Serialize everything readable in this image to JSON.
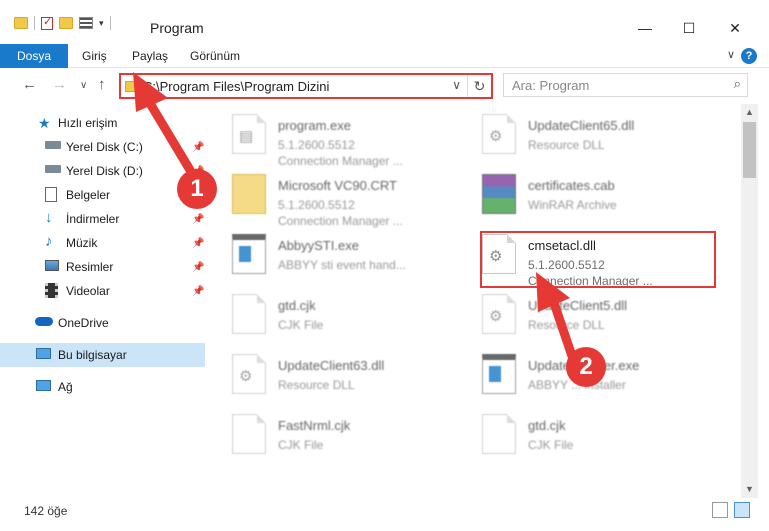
{
  "window": {
    "title": "Program",
    "minimize": "—",
    "maximize": "☐",
    "close": "✕"
  },
  "ribbon": {
    "tabs": [
      {
        "label": "Dosya"
      },
      {
        "label": "Giriş"
      },
      {
        "label": "Paylaş"
      },
      {
        "label": "Görünüm"
      }
    ],
    "help": "?"
  },
  "nav": {
    "back": "←",
    "forward": "→",
    "recent": "∨",
    "up": "↑",
    "address": "C:\\Program Files\\Program Dizini",
    "search_placeholder": "Ara: Program"
  },
  "sidebar": {
    "items": [
      {
        "label": "Hızlı erişim",
        "icon": "star-icon",
        "pinned": false
      },
      {
        "label": "Yerel Disk (C:)",
        "icon": "drive-icon",
        "pinned": true
      },
      {
        "label": "Yerel Disk (D:)",
        "icon": "drive-icon",
        "pinned": true
      },
      {
        "label": "Belgeler",
        "icon": "documents-icon",
        "pinned": true
      },
      {
        "label": "İndirmeler",
        "icon": "download-icon",
        "pinned": true
      },
      {
        "label": "Müzik",
        "icon": "music-icon",
        "pinned": true
      },
      {
        "label": "Resimler",
        "icon": "pictures-icon",
        "pinned": true
      },
      {
        "label": "Videolar",
        "icon": "video-icon",
        "pinned": true
      },
      {
        "label": "OneDrive",
        "icon": "cloud-icon",
        "pinned": false
      },
      {
        "label": "Bu bilgisayar",
        "icon": "computer-icon",
        "pinned": false
      },
      {
        "label": "Ağ",
        "icon": "network-icon",
        "pinned": false
      }
    ]
  },
  "files": [
    {
      "name": "program.exe",
      "line1": "5.1.2600.5512",
      "line2": "Connection Manager ...",
      "icon": "exe-icon"
    },
    {
      "name": "UpdateClient65.dll",
      "line1": "Resource DLL",
      "line2": "",
      "icon": "dll-icon"
    },
    {
      "name": "Microsoft VC90.CRT",
      "line1": "5.1.2600.5512",
      "line2": "Connection Manager ...",
      "icon": "folder-icon"
    },
    {
      "name": "certificates.cab",
      "line1": "WinRAR Archive",
      "line2": "",
      "icon": "winrar-icon"
    },
    {
      "name": "AbbyySTI.exe",
      "line1": "ABBYY sti event hand...",
      "line2": "",
      "icon": "app-window-icon"
    },
    {
      "name": "cmsetacl.dll",
      "line1": "5.1.2600.5512",
      "line2": "Connection Manager ...",
      "icon": "dll-gear-icon"
    },
    {
      "name": "gtd.cjk",
      "line1": "CJK File",
      "line2": "",
      "icon": "blank-file-icon"
    },
    {
      "name": "UpdateClient5.dll",
      "line1": "Resource DLL",
      "line2": "",
      "icon": "dll-icon"
    },
    {
      "name": "UpdateClient63.dll",
      "line1": "Resource DLL",
      "line2": "",
      "icon": "dll-icon"
    },
    {
      "name": "UpdateInstaller.exe",
      "line1": "ABBYY ... installer",
      "line2": "",
      "icon": "app-window-icon"
    },
    {
      "name": "FastNrml.cjk",
      "line1": "CJK File",
      "line2": "",
      "icon": "blank-file-icon"
    },
    {
      "name": "gtd.cjk",
      "line1": "CJK File",
      "line2": "",
      "icon": "blank-file-icon"
    }
  ],
  "status": {
    "count": "142 öğe"
  },
  "annotations": {
    "step1": "1",
    "step2": "2",
    "accent": "#e53935"
  }
}
